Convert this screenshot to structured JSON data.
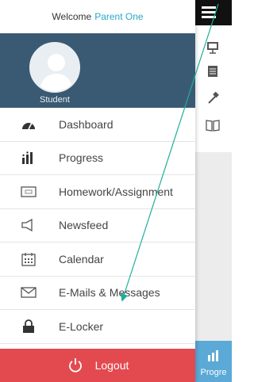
{
  "drawer": {
    "welcome_text": "Welcome",
    "user_name": "Parent One",
    "profile_role": "Student",
    "menu_items": [
      {
        "label": "Dashboard",
        "icon": "dashboard-gauge-icon"
      },
      {
        "label": "Progress",
        "icon": "progress-bars-icon"
      },
      {
        "label": "Homework/Assignment",
        "icon": "homework-icon"
      },
      {
        "label": "Newsfeed",
        "icon": "megaphone-icon"
      },
      {
        "label": "Calendar",
        "icon": "calendar-icon"
      },
      {
        "label": "E-Mails & Messages",
        "icon": "envelope-icon"
      },
      {
        "label": "E-Locker",
        "icon": "lock-icon"
      }
    ],
    "logout_label": "Logout"
  },
  "background_app": {
    "bottom_tab_label": "Progre"
  },
  "colors": {
    "profile_bg": "#3a5a73",
    "accent_name": "#27a9c7",
    "logout_bg": "#e34a4f",
    "tab_bg": "#5aa9d6",
    "annotation_arrow": "#1fae9a"
  }
}
